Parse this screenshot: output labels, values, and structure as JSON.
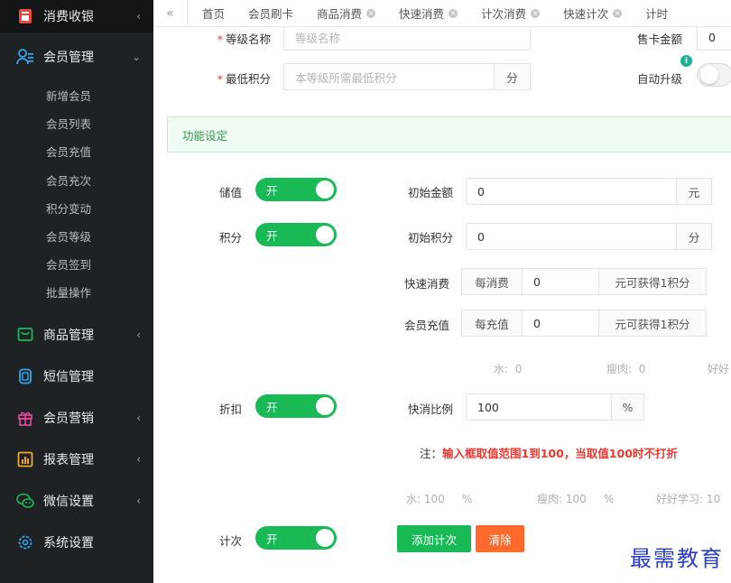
{
  "sidebar": {
    "top": {
      "label": "消费收银",
      "icon": "cashier-icon"
    },
    "groups": [
      {
        "label": "会员管理",
        "icon": "members-icon",
        "expanded": true,
        "items": [
          {
            "label": "新增会员"
          },
          {
            "label": "会员列表"
          },
          {
            "label": "会员充值"
          },
          {
            "label": "会员充次"
          },
          {
            "label": "积分变动"
          },
          {
            "label": "会员等级"
          },
          {
            "label": "会员签到"
          },
          {
            "label": "批量操作"
          }
        ]
      },
      {
        "label": "商品管理",
        "icon": "goods-icon"
      },
      {
        "label": "短信管理",
        "icon": "sms-icon"
      },
      {
        "label": "会员营销",
        "icon": "gift-icon"
      },
      {
        "label": "报表管理",
        "icon": "report-icon"
      },
      {
        "label": "微信设置",
        "icon": "wechat-icon"
      },
      {
        "label": "系统设置",
        "icon": "settings-icon"
      }
    ]
  },
  "tabs": [
    {
      "label": "首页"
    },
    {
      "label": "会员刷卡"
    },
    {
      "label": "商品消费"
    },
    {
      "label": "快速消费"
    },
    {
      "label": "计次消费"
    },
    {
      "label": "快速计次"
    },
    {
      "label": "计时"
    }
  ],
  "form": {
    "level_name_label": "等级名称",
    "level_name_placeholder": "等级名称",
    "card_price_label": "售卡金额",
    "card_price_value": "0",
    "min_points_label": "最低积分",
    "min_points_placeholder": "本等级所需最低积分",
    "min_points_unit": "分",
    "auto_upgrade_label": "自动升级"
  },
  "section_title": "功能设定",
  "stored_value": {
    "label": "储值",
    "switch": "开",
    "init_label": "初始金额",
    "init_value": "0",
    "unit": "元"
  },
  "points": {
    "label": "积分",
    "switch": "开",
    "init_label": "初始积分",
    "init_value": "0",
    "unit": "分",
    "quick_label": "快速消费",
    "quick_prefix": "每消费",
    "quick_value": "0",
    "quick_suffix": "元可获得1积分",
    "recharge_label": "会员充值",
    "recharge_prefix": "每充值",
    "recharge_value": "0",
    "recharge_suffix": "元可获得1积分",
    "extra": [
      {
        "name": "水:",
        "value": "0"
      },
      {
        "name": "瘦肉:",
        "value": "0"
      },
      {
        "name": "好好"
      }
    ]
  },
  "discount": {
    "label": "折扣",
    "switch": "开",
    "ratio_label": "快消比例",
    "ratio_value": "100",
    "unit": "%",
    "note_prefix": "注：",
    "note_text": "输入框取值范围1到100，当取值100时不打折",
    "extra": [
      {
        "name": "水:",
        "value": "100",
        "unit": "%"
      },
      {
        "name": "瘦肉:",
        "value": "100",
        "unit": "%"
      },
      {
        "name": "好好学习:",
        "value": "10"
      }
    ]
  },
  "count": {
    "label": "计次",
    "switch": "开",
    "add_button": "添加计次",
    "clear_button": "清除"
  },
  "watermark": "最需教育",
  "colors": {
    "accent": "#19b955",
    "danger": "#f0372e",
    "clear": "#ff6a2c",
    "sidebar": "#1f2225"
  }
}
